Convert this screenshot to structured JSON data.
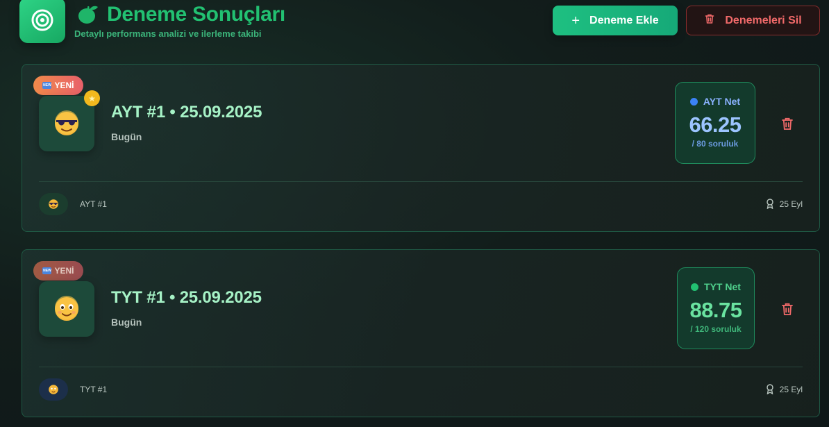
{
  "header": {
    "title": "Deneme Sonuçları",
    "subtitle": "Detaylı performans analizi ve ilerleme takibi",
    "add_button": "Deneme Ekle",
    "delete_button": "Denemeleri Sil"
  },
  "colors": {
    "accent_green": "#22c172",
    "danger_red": "#f26a6a",
    "ayt_blue": "#3b82f6",
    "tyt_green": "#22c172"
  },
  "exams": [
    {
      "badge": "YENİ",
      "badge_chip": "NEW",
      "title": "AYT #1 • 25.09.2025",
      "relative_date": "Bugün",
      "emoji": "sunglasses-face",
      "has_star": true,
      "net_label": "AYT Net",
      "net_value": "66.25",
      "net_sub": "/ 80 soruluk",
      "footer_label": "AYT #1",
      "footer_date": "25 Eyl"
    },
    {
      "badge": "YENİ",
      "badge_chip": "NEW",
      "title": "TYT #1 • 25.09.2025",
      "relative_date": "Bugün",
      "emoji": "smiling-face",
      "has_star": false,
      "net_label": "TYT Net",
      "net_value": "88.75",
      "net_sub": "/ 120 soruluk",
      "footer_label": "TYT #1",
      "footer_date": "25 Eyl"
    }
  ]
}
